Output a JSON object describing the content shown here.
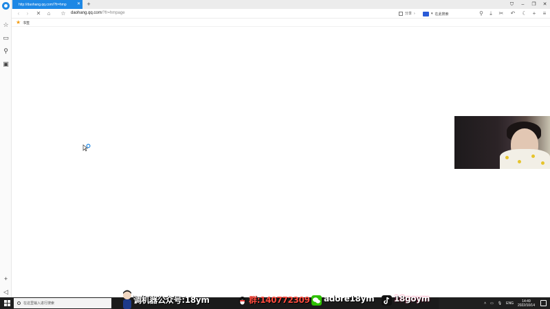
{
  "browser": {
    "tab": {
      "title": "http://daohang.qq.com/?fr=hmp"
    },
    "address": {
      "host": "daohang.qq.com",
      "path": "/?fr=hmpage"
    },
    "share_label": "分享",
    "search_placeholder": "在此搜索",
    "bookmarks": [
      {
        "label": "书签"
      }
    ],
    "accent_color": "#1e88e5"
  },
  "taskbar": {
    "search_placeholder": "在这里输入进行搜索",
    "tray": {
      "language": "ENG",
      "time": "14:49",
      "date": "2022/10/14"
    }
  },
  "overlay": {
    "public_account": "调机器公众号:18ym",
    "qq_group": "群:140772309",
    "wechat": "adore18ym",
    "douyin": "18goym"
  }
}
